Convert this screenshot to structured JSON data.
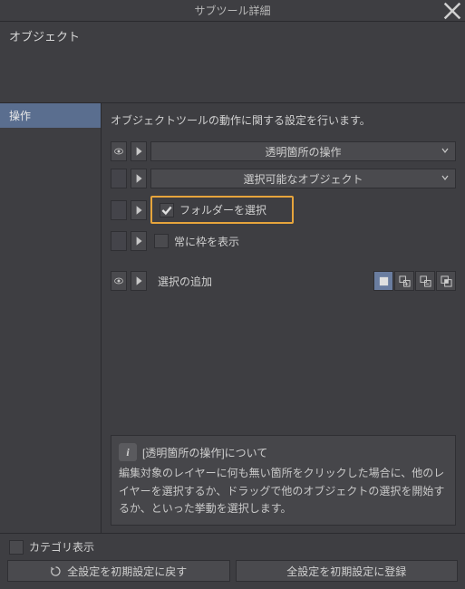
{
  "window": {
    "title": "サブツール詳細"
  },
  "header": {
    "label": "オブジェクト"
  },
  "sidebar": {
    "items": [
      {
        "label": "操作"
      }
    ]
  },
  "content": {
    "description": "オブジェクトツールの動作に関する設定を行います。",
    "dropdown1": "透明箇所の操作",
    "dropdown2": "選択可能なオブジェクト",
    "check_folder": "フォルダーを選択",
    "check_frame": "常に枠を表示",
    "selection_label": "選択の追加"
  },
  "info": {
    "title": "[透明箇所の操作]について",
    "body": "編集対象のレイヤーに何も無い箇所をクリックした場合に、他のレイヤーを選択するか、ドラッグで他のオブジェクトの選択を開始するか、といった挙動を選択します。"
  },
  "footer": {
    "category_label": "カテゴリ表示",
    "reset_btn": "全設定を初期設定に戻す",
    "register_btn": "全設定を初期設定に登録"
  }
}
